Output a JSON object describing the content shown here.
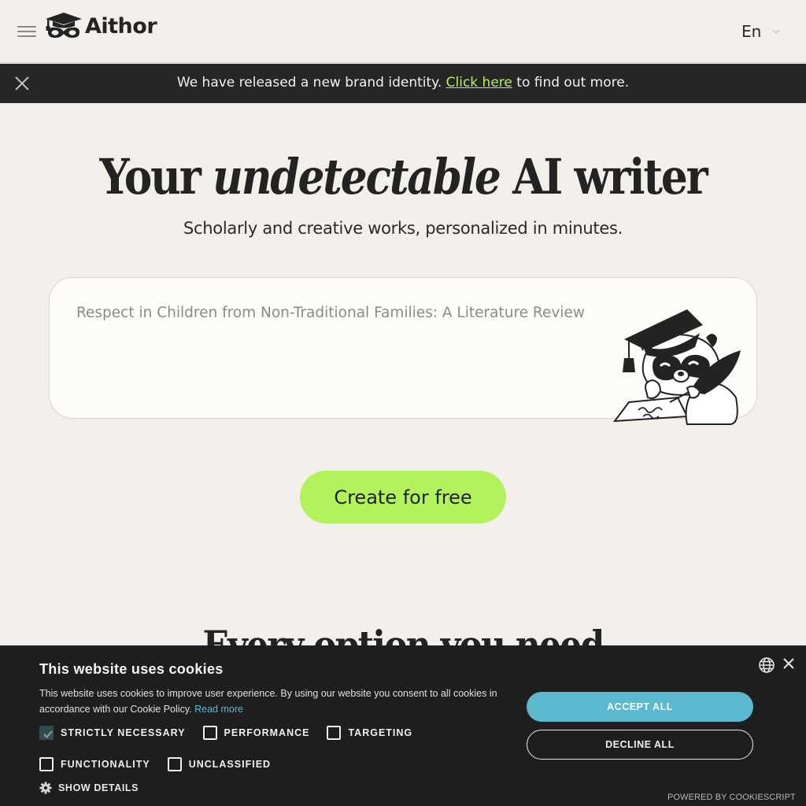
{
  "header": {
    "menu_icon": "hamburger-menu-icon",
    "logo_icon": "graduation-cap-mask-icon",
    "logo_text": "Aithor",
    "language": "En",
    "language_icon": "chevron-down-icon"
  },
  "banner": {
    "close_icon": "close-icon",
    "text_before": "We have released a new brand identity. ",
    "link_text": "Click here",
    "text_after": " to find out more.",
    "link_color": "#b2f25c"
  },
  "hero": {
    "title_before": "Your ",
    "title_emphasis": "undetectable",
    "title_after": " AI writer",
    "subtitle": "Scholarly and creative works, personalized in minutes.",
    "prompt_placeholder": "Respect in Children from Non-Traditional Families: A Literature Review",
    "mascot_icon": "raccoon-scholar-illustration",
    "cta_label": "Create for free",
    "cta_color": "#b2f25c"
  },
  "section": {
    "title": "Every option you need"
  },
  "cookie_banner": {
    "title": "This website uses cookies",
    "description": "This website uses cookies to improve user experience. By using our website you consent to all cookies in accordance with our Cookie Policy. ",
    "read_more": "Read more",
    "categories": [
      {
        "label": "STRICTLY NECESSARY",
        "checked": true
      },
      {
        "label": "PERFORMANCE",
        "checked": false
      },
      {
        "label": "TARGETING",
        "checked": false
      },
      {
        "label": "FUNCTIONALITY",
        "checked": false
      },
      {
        "label": "UNCLASSIFIED",
        "checked": false
      }
    ],
    "show_details": "SHOW DETAILS",
    "accept_all": "ACCEPT ALL",
    "decline_all": "DECLINE ALL",
    "powered_by": "POWERED BY COOKIESCRIPT",
    "accent_color": "#5bb8cf",
    "globe_icon": "globe-icon",
    "close_icon": "close-icon",
    "gear_icon": "gear-icon"
  }
}
